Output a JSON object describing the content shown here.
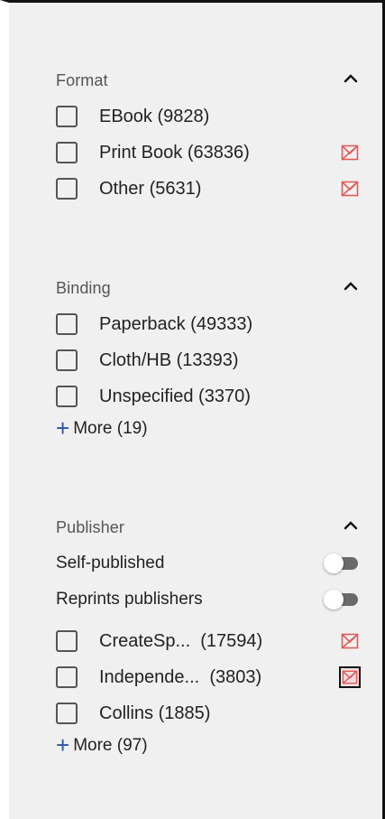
{
  "format": {
    "title": "Format",
    "items": [
      {
        "label": "EBook (9828)",
        "exclude": false
      },
      {
        "label": "Print Book (63836)",
        "exclude": true,
        "exclude_selected": false
      },
      {
        "label": "Other (5631)",
        "exclude": true,
        "exclude_selected": false
      }
    ]
  },
  "binding": {
    "title": "Binding",
    "items": [
      {
        "label": "Paperback (49333)"
      },
      {
        "label": "Cloth/HB (13393)"
      },
      {
        "label": "Unspecified (3370)"
      }
    ],
    "more_label": "More (19)"
  },
  "publisher": {
    "title": "Publisher",
    "toggles": [
      {
        "label": "Self-published",
        "on": false
      },
      {
        "label": "Reprints publishers",
        "on": false
      }
    ],
    "items": [
      {
        "label": "CreateSp...  (17594)",
        "exclude": true,
        "exclude_selected": false
      },
      {
        "label": "Independe...  (3803)",
        "exclude": true,
        "exclude_selected": true
      },
      {
        "label": "Collins (1885)",
        "exclude": false
      }
    ],
    "more_label": "More (97)"
  },
  "icons": {
    "caret": "chevron-up-icon",
    "exclude": "exclude-icon",
    "more": "plus-icon"
  },
  "colors": {
    "exclude": "#e05a5a",
    "more_plus": "#2a55a8",
    "toggle_track": "#6a6a6a"
  }
}
